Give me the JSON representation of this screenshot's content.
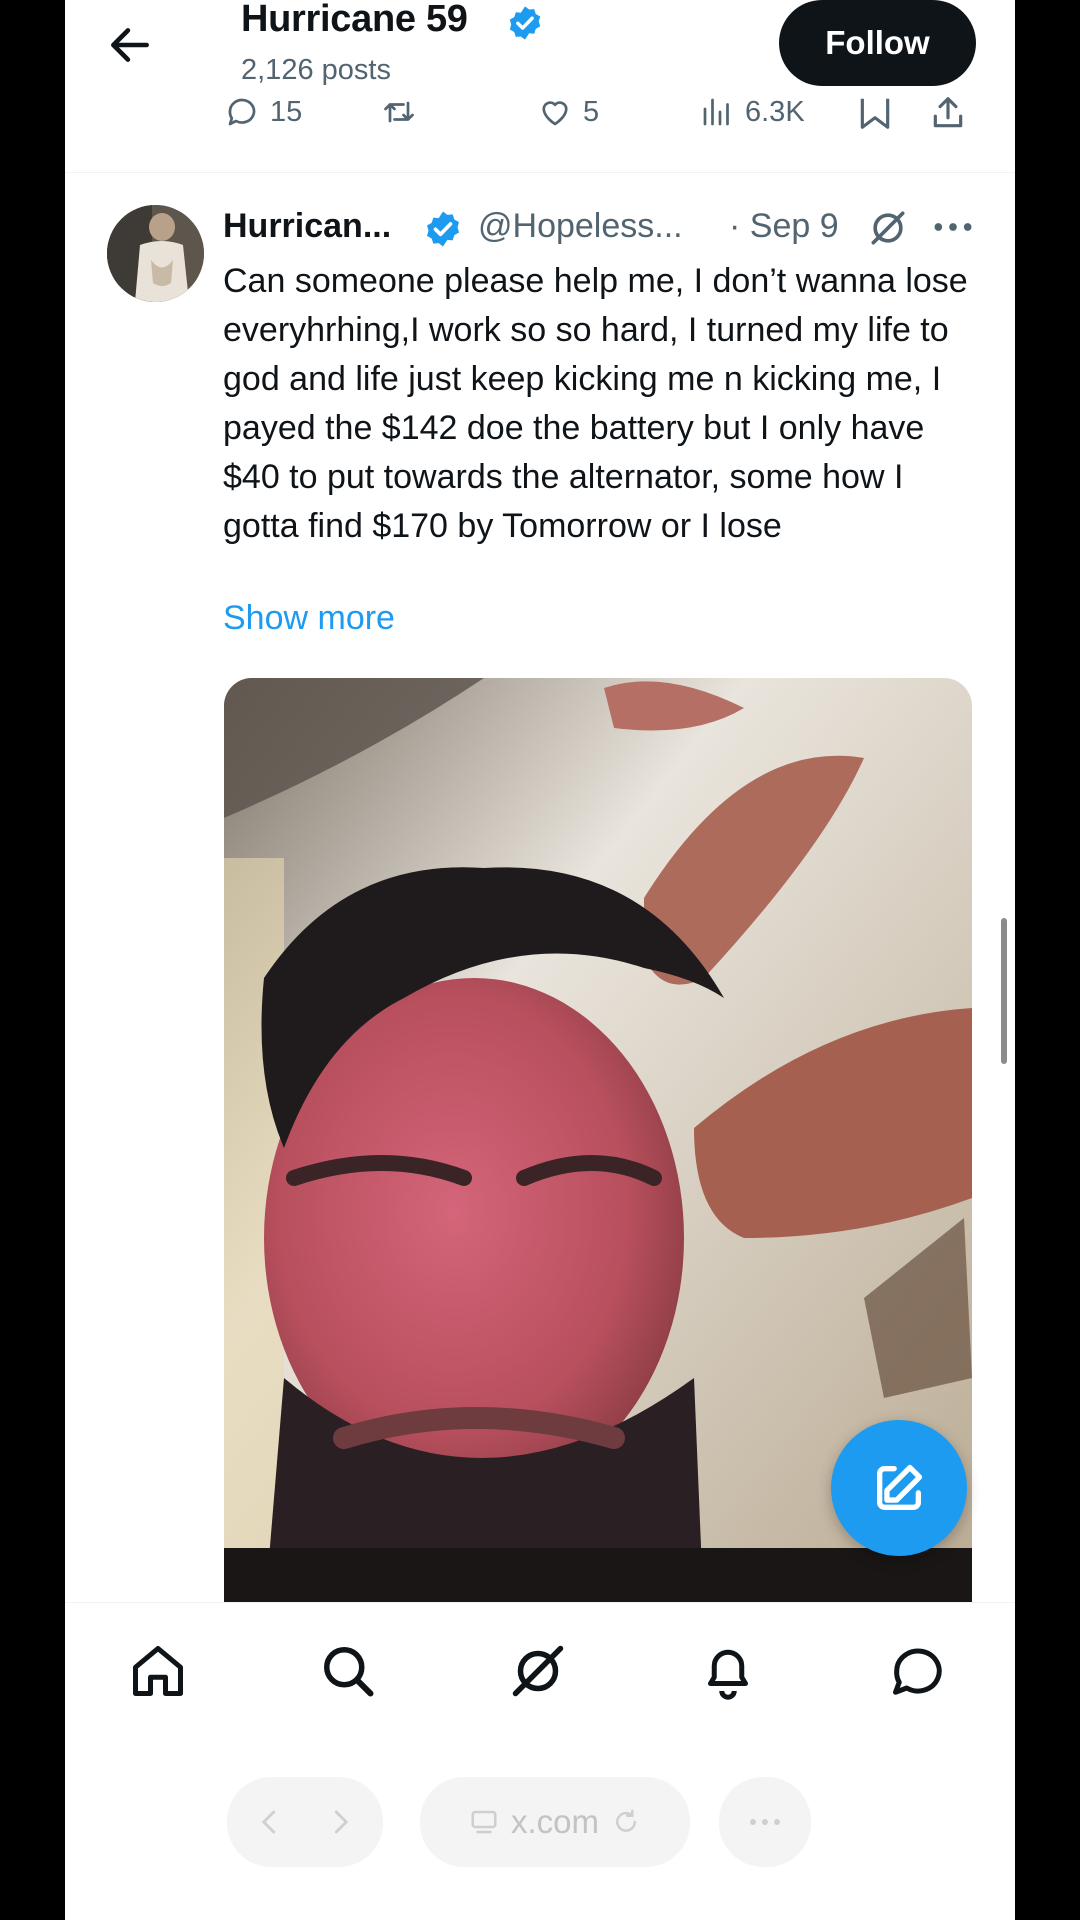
{
  "header": {
    "profile_name": "Hurricane 59",
    "post_count": "2,126 posts",
    "follow_label": "Follow"
  },
  "previous_tweet": {
    "reply_count": "15",
    "like_count": "5",
    "view_count": "6.3K"
  },
  "tweet": {
    "author_name": "Hurrican...",
    "handle": "@Hopeless...",
    "date": "· Sep 9",
    "text": "Can someone please help me, I don’t wanna lose everyhrhing,I work so so hard, I turned my life to god and life just keep kicking me n kicking me, I payed the $142 doe the battery but I only have $40 to put towards the alternator, some how I gotta find $170 by Tomorrow or I lose",
    "show_more": "Show more"
  },
  "browser": {
    "url": "x.com"
  },
  "colors": {
    "accent": "#1d9bf0",
    "text_primary": "#0f1419",
    "text_secondary": "#536471",
    "follow_button_bg": "#0f1419"
  },
  "icons": {
    "back": "arrow-left-icon",
    "verified": "verified-badge-icon",
    "reply": "reply-icon",
    "retweet": "retweet-icon",
    "like": "heart-icon",
    "views": "views-icon",
    "bookmark": "bookmark-icon",
    "share": "share-icon",
    "grok": "grok-icon",
    "more": "more-icon",
    "compose": "compose-icon",
    "home": "home-icon",
    "search": "search-icon",
    "notifications": "bell-icon",
    "messages": "messages-icon"
  }
}
